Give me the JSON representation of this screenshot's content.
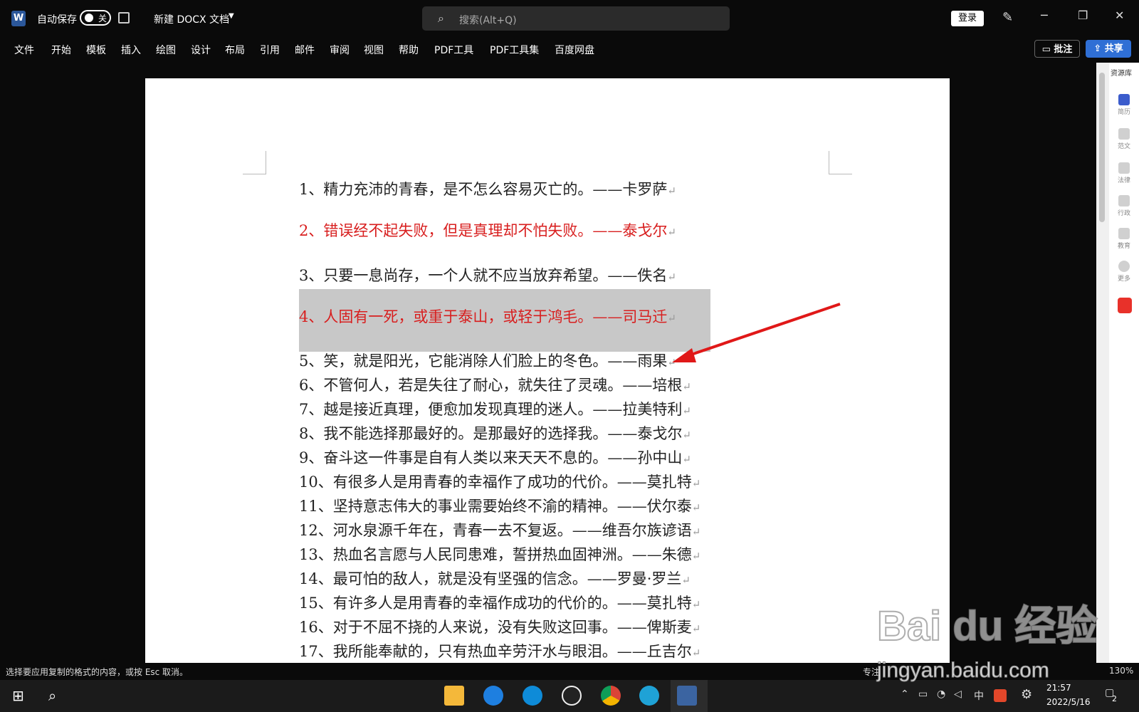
{
  "titlebar": {
    "app_logo": "W",
    "autosave_label": "自动保存",
    "autosave_state": "关",
    "document_title": "新建 DOCX 文档",
    "search_placeholder": "搜索(Alt+Q)",
    "login_label": "登录",
    "icons": [
      "word-logo-icon",
      "save-icon",
      "chevron-down-icon",
      "search-icon",
      "pen-icon",
      "minimize-icon",
      "restore-icon",
      "close-icon"
    ]
  },
  "menu": {
    "items": [
      "文件",
      "开始",
      "模板",
      "插入",
      "绘图",
      "设计",
      "布局",
      "引用",
      "邮件",
      "审阅",
      "视图",
      "帮助",
      "PDF工具",
      "PDF工具集",
      "百度网盘"
    ],
    "comment_label": "批注",
    "share_label": "共享"
  },
  "document": {
    "lines": [
      {
        "text": "1、精力充沛的青春，是不怎么容易灭亡的。——卡罗萨",
        "color": "#222222"
      },
      {
        "text": "2、错误经不起失败，但是真理却不怕失败。——泰戈尔",
        "color": "#d81e1e"
      },
      {
        "text": "3、只要一息尚存，一个人就不应当放弃希望。——佚名",
        "color": "#222222"
      },
      {
        "text": "4、人固有一死，或重于泰山，或轻于鸿毛。——司马迁",
        "color": "#d81e1e",
        "selected": true
      },
      {
        "text": "5、笑，就是阳光，它能消除人们脸上的冬色。——雨果",
        "color": "#222222"
      },
      {
        "text": "6、不管何人，若是失往了耐心，就失往了灵魂。——培根",
        "color": "#222222"
      },
      {
        "text": "7、越是接近真理，便愈加发现真理的迷人。——拉美特利",
        "color": "#222222"
      },
      {
        "text": "8、我不能选择那最好的。是那最好的选择我。——泰戈尔",
        "color": "#222222"
      },
      {
        "text": "9、奋斗这一件事是自有人类以来天天不息的。——孙中山",
        "color": "#222222"
      },
      {
        "text": "10、有很多人是用青春的幸福作了成功的代价。——莫扎特",
        "color": "#222222"
      },
      {
        "text": "11、坚持意志伟大的事业需要始终不渝的精神。——伏尔泰",
        "color": "#222222"
      },
      {
        "text": "12、河水泉源千年在，青春一去不复返。——维吾尔族谚语",
        "color": "#222222"
      },
      {
        "text": "13、热血名言愿与人民同患难，誓拼热血固神洲。——朱德",
        "color": "#222222"
      },
      {
        "text": "14、最可怕的敌人，就是没有坚强的信念。——罗曼·罗兰",
        "color": "#222222"
      },
      {
        "text": "15、有许多人是用青春的幸福作成功的代价的。——莫扎特",
        "color": "#222222"
      },
      {
        "text": "16、对于不屈不挠的人来说，没有失败这回事。——俾斯麦",
        "color": "#222222"
      },
      {
        "text": "17、我所能奉献的，只有热血辛劳汗水与眼泪。——丘吉尔",
        "color": "#222222"
      }
    ],
    "paragraph_mark": "↵"
  },
  "side_pane": {
    "header": "资源库",
    "items": [
      "简历",
      "范文",
      "法律",
      "行政",
      "教育",
      "更多"
    ]
  },
  "statusbar": {
    "message": "选择要应用复制的格式的内容，或按 Esc 取消。",
    "focus_label": "专注",
    "zoom": "130%"
  },
  "taskbar": {
    "tray_ime": "中",
    "time": "21:57",
    "date": "2022/5/16",
    "notification_count": "2"
  },
  "watermark": {
    "brand": "Bai du 经验",
    "url": "jingyan.baidu.com"
  }
}
